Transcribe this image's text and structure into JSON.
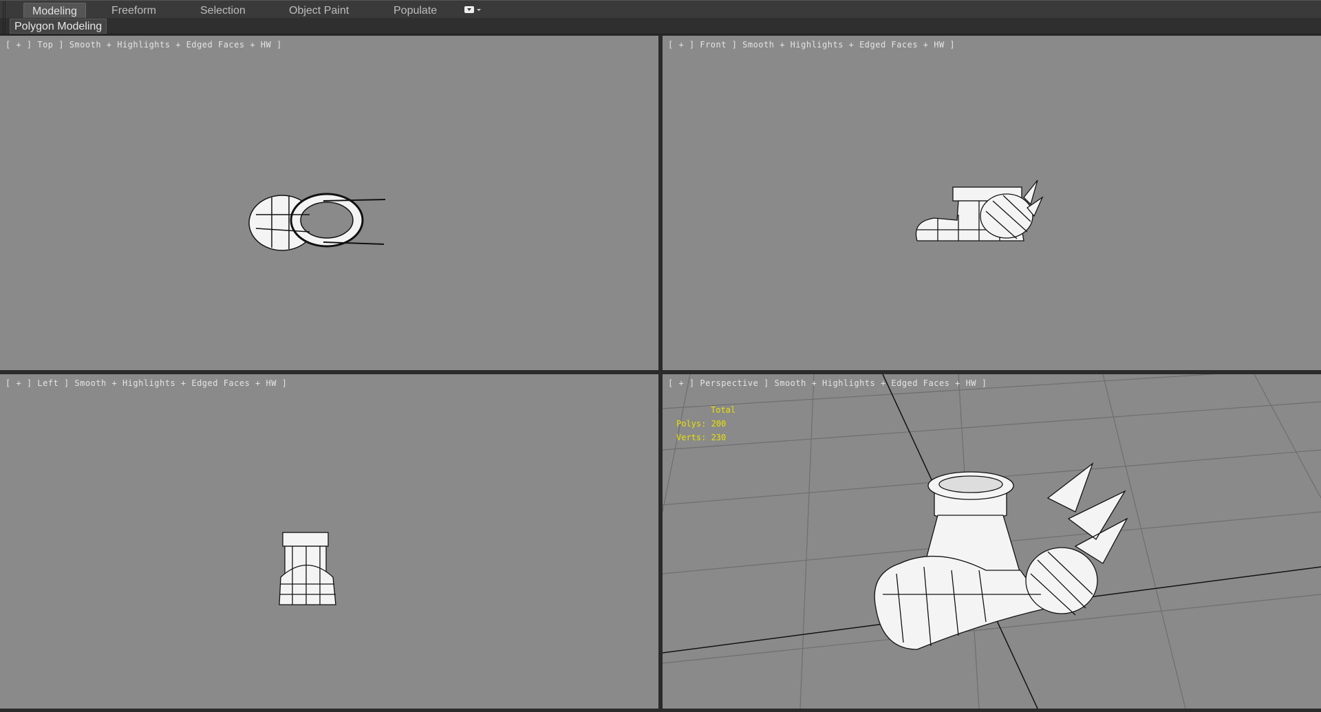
{
  "tabs": [
    {
      "label": "Modeling",
      "active": true
    },
    {
      "label": "Freeform"
    },
    {
      "label": "Selection"
    },
    {
      "label": "Object Paint"
    },
    {
      "label": "Populate"
    }
  ],
  "tab_menu_icon": "dropdown-menu-icon",
  "ribbon": {
    "panel_label": "Polygon Modeling"
  },
  "viewports": {
    "top": {
      "label": "[ + ] Top ] Smooth + Highlights + Edged Faces + HW ]"
    },
    "front": {
      "label": "[ + ] Front ] Smooth + Highlights + Edged Faces + HW ]"
    },
    "left": {
      "label": "[ + ] Left ] Smooth + Highlights + Edged Faces + HW ]"
    },
    "perspective": {
      "label": "[ + ] Perspective ] Smooth + Highlights + Edged Faces + HW ]",
      "stats": {
        "title": "Total",
        "polys": "Polys: 200",
        "verts": "Verts: 230"
      }
    }
  },
  "colors": {
    "viewport_bg": "#8a8a8a",
    "stats_text": "#e8e000"
  }
}
